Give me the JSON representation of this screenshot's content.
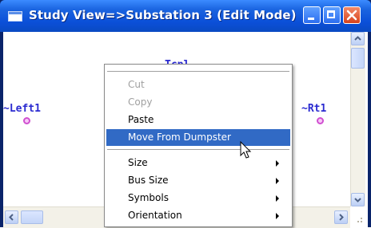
{
  "window": {
    "title": "Study View=>Substation 3 (Edit Mode)"
  },
  "canvas": {
    "nodes": [
      {
        "label": "Tcpl"
      },
      {
        "label": "~Left1"
      },
      {
        "label": "~Rt1"
      }
    ]
  },
  "context_menu": {
    "items": [
      {
        "label": "Cut",
        "enabled": false
      },
      {
        "label": "Copy",
        "enabled": false
      },
      {
        "label": "Paste",
        "enabled": true
      },
      {
        "label": "Move From Dumpster",
        "enabled": true,
        "highlighted": true
      },
      {
        "label": "Size",
        "submenu": true
      },
      {
        "label": "Bus Size",
        "submenu": true
      },
      {
        "label": "Symbols",
        "submenu": true
      },
      {
        "label": "Orientation",
        "submenu": true
      }
    ]
  },
  "colors": {
    "title_bar": "#0b4fd8",
    "menu_highlight": "#316ac5",
    "node_label": "#2a2ad0",
    "node_marker": "#d050d0"
  },
  "icons": [
    "window-icon",
    "minimize-icon",
    "maximize-icon",
    "close-icon",
    "scroll-up-icon",
    "scroll-down-icon",
    "scroll-left-icon",
    "scroll-right-icon",
    "submenu-arrow-icon",
    "mouse-pointer-icon",
    "resize-grip-icon"
  ]
}
